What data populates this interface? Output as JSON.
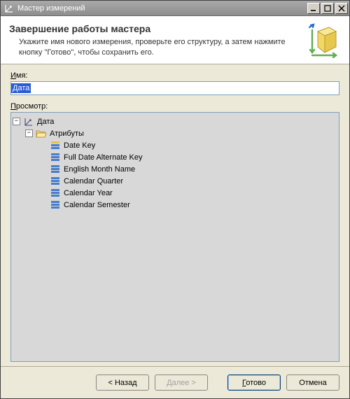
{
  "window": {
    "title": "Мастер измерений"
  },
  "header": {
    "title": "Завершение работы мастера",
    "subtitle": "Укажите имя нового измерения, проверьте его структуру, а затем нажмите кнопку \"Готово\", чтобы сохранить его."
  },
  "form": {
    "name_label_underlined": "И",
    "name_label_rest": "мя:",
    "name_value": "Дата",
    "preview_label_underlined": "П",
    "preview_label_rest": "росмотр:"
  },
  "tree": {
    "root": {
      "label": "Дата"
    },
    "attributes_folder": {
      "label": "Атрибуты"
    },
    "attributes": [
      {
        "label": "Date Key",
        "key": true
      },
      {
        "label": "Full Date Alternate Key",
        "key": false
      },
      {
        "label": "English Month Name",
        "key": false
      },
      {
        "label": "Calendar Quarter",
        "key": false
      },
      {
        "label": "Calendar Year",
        "key": false
      },
      {
        "label": "Calendar Semester",
        "key": false
      }
    ]
  },
  "buttons": {
    "back": "< Назад",
    "next": "Далее >",
    "finish": "Готово",
    "cancel": "Отмена"
  }
}
